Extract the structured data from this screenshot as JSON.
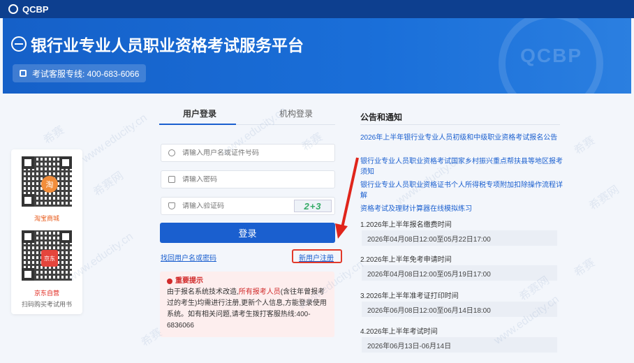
{
  "topbar": {
    "brand": "QCBP"
  },
  "banner": {
    "title": "银行业专业人员职业资格考试服务平台",
    "hotline": "考试客服专线: 400-683-6066",
    "seal_text": "QCBP"
  },
  "qr_panel": {
    "taobao_label": "淘宝商城",
    "taobao_badge": "淘",
    "jd_label": "京东自营",
    "jd_badge": "京东",
    "scan_hint": "扫码购买考试用书"
  },
  "login": {
    "tabs": [
      "用户登录",
      "机构登录"
    ],
    "username_placeholder": "请输入用户名或证件号码",
    "password_placeholder": "请输入密码",
    "captcha_placeholder": "请输入验证码",
    "captcha_text": "2+3",
    "submit_label": "登录",
    "forgot_link": "找回用户名或密码",
    "register_link": "新用户注册"
  },
  "notice": {
    "title": "重要提示",
    "text_1": "由于报名系统技术改造,",
    "highlight": "所有报考人员",
    "text_2": "(含往年曾报考过的考生)均需进行注册,更新个人信息,方能登录使用系统。如有相关问题,请考生拨打客服热线:400-6836066"
  },
  "announcements": {
    "title": "公告和通知",
    "links": [
      "2026年上半年银行业专业人员初级和中级职业资格考试报名公告",
      "银行业专业人员职业资格考试国家乡村振兴重点帮扶县等地区报考须知",
      "银行业专业人员职业资格证书个人所得税专项附加扣除操作流程详解",
      "资格考试及理财计算器在线模拟练习"
    ],
    "schedule": [
      {
        "label": "1.2026年上半年报名缴费时间",
        "value": "2026年04月08日12:00至05月22日17:00"
      },
      {
        "label": "2.2026年上半年免考申请时间",
        "value": "2026年04月08日12:00至05月19日17:00"
      },
      {
        "label": "3.2026年上半年准考证打印时间",
        "value": "2026年06月08日12:00至06月14日18:00"
      },
      {
        "label": "4.2026年上半年考试时间",
        "value": "2026年06月13日-06月14日"
      }
    ]
  },
  "watermark": {
    "cn": "希赛",
    "site": "www.educity.cn",
    "net": "希赛网"
  },
  "colors": {
    "primary": "#1a5fcf",
    "topbar": "#0d3f8f",
    "alert": "#d12a2a"
  }
}
